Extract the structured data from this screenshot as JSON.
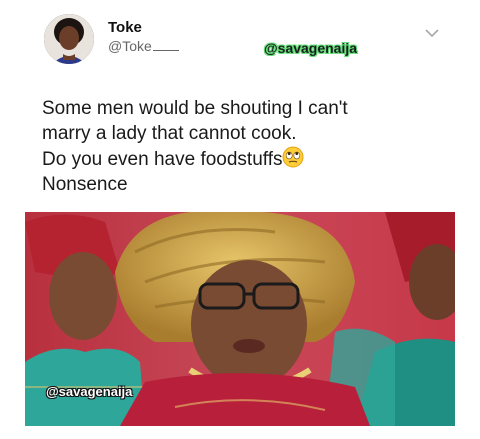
{
  "tweet": {
    "author_name": "Toke",
    "author_handle": "@Toke",
    "watermark_top": "@savagenaija",
    "lines": [
      "Some men would be shouting I can't",
      "marry a lady that cannot cook.",
      "Do you even have foodstuffs",
      "Nonsence"
    ],
    "emoji": "rolling-eyes-emoji",
    "menu_icon": "chevron-down-icon"
  },
  "image": {
    "watermark": "@savagenaija",
    "colors": {
      "gele_gold": "#c9a349",
      "red_background": "#b8303d",
      "teal_dress": "#2fa69a",
      "skin": "#7a4b33"
    }
  }
}
